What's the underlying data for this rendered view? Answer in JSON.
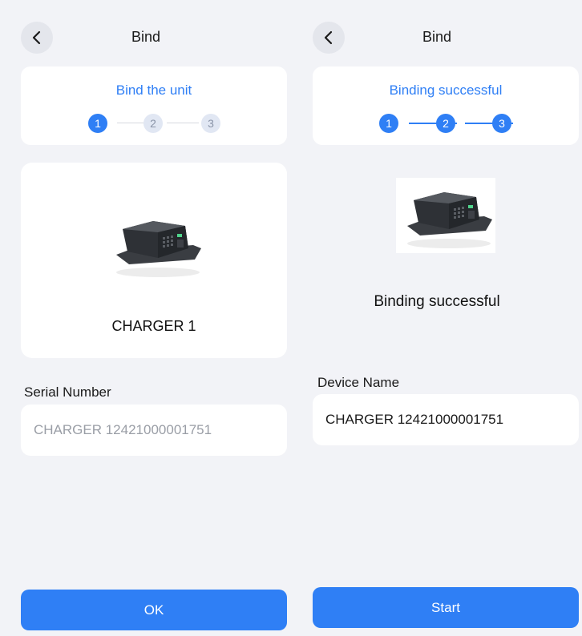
{
  "left": {
    "header": {
      "title": "Bind"
    },
    "stepper": {
      "title": "Bind the unit",
      "steps": [
        "1",
        "2",
        "3"
      ],
      "current": 1
    },
    "device": {
      "name": "CHARGER 1"
    },
    "field": {
      "label": "Serial Number",
      "value": "CHARGER 12421000001751"
    },
    "button": {
      "label": "OK"
    }
  },
  "right": {
    "header": {
      "title": "Bind"
    },
    "stepper": {
      "title": "Binding successful",
      "steps": [
        "1",
        "2",
        "3"
      ],
      "current": 3
    },
    "status": {
      "text": "Binding successful"
    },
    "field": {
      "label": "Device Name",
      "value": "CHARGER 12421000001751"
    },
    "button": {
      "label": "Start"
    }
  },
  "colors": {
    "accent": "#2f7ff5",
    "background": "#f2f3f7",
    "card": "#ffffff",
    "step_idle": "#e1e7f3"
  },
  "icons": {
    "back": "chevron-left-icon"
  }
}
